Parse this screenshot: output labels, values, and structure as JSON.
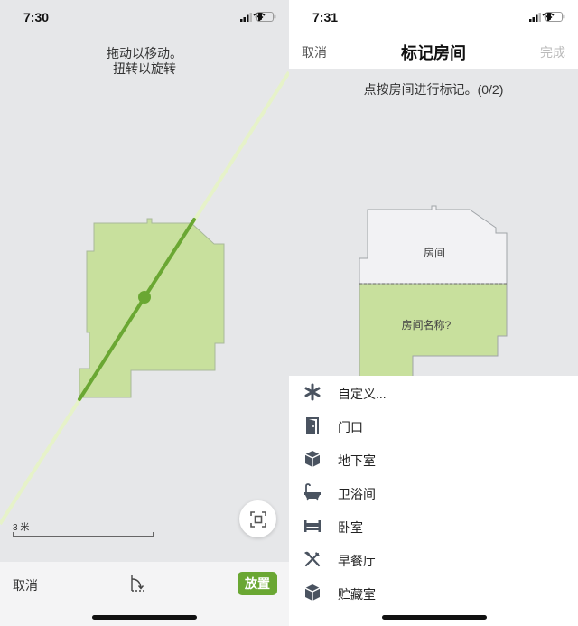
{
  "left_screen": {
    "status": {
      "time": "7:30"
    },
    "hint": {
      "line1": "拖动以移动。",
      "line2": "扭转以旋转"
    },
    "scale": {
      "label": "3 米"
    },
    "toolbar": {
      "cancel_label": "取消",
      "place_label": "放置"
    },
    "colors": {
      "accent": "#6aa733",
      "room_fill": "#c8e09d",
      "divider_line": "#e6f2c9"
    }
  },
  "right_screen": {
    "status": {
      "time": "7:31"
    },
    "nav": {
      "cancel_label": "取消",
      "title": "标记房间",
      "done_label": "完成"
    },
    "instruction": "点按房间进行标记。(0/2)",
    "map": {
      "room_unlabeled": "房间",
      "room_name_prompt": "房间名称?"
    },
    "room_list": [
      {
        "icon": "asterisk-icon",
        "label": "自定义..."
      },
      {
        "icon": "door-icon",
        "label": "门口"
      },
      {
        "icon": "cube-icon",
        "label": "地下室"
      },
      {
        "icon": "bathtub-icon",
        "label": "卫浴间"
      },
      {
        "icon": "bed-icon",
        "label": "卧室"
      },
      {
        "icon": "fork-knife-icon",
        "label": "早餐厅"
      },
      {
        "icon": "box-icon",
        "label": "贮藏室"
      }
    ]
  }
}
